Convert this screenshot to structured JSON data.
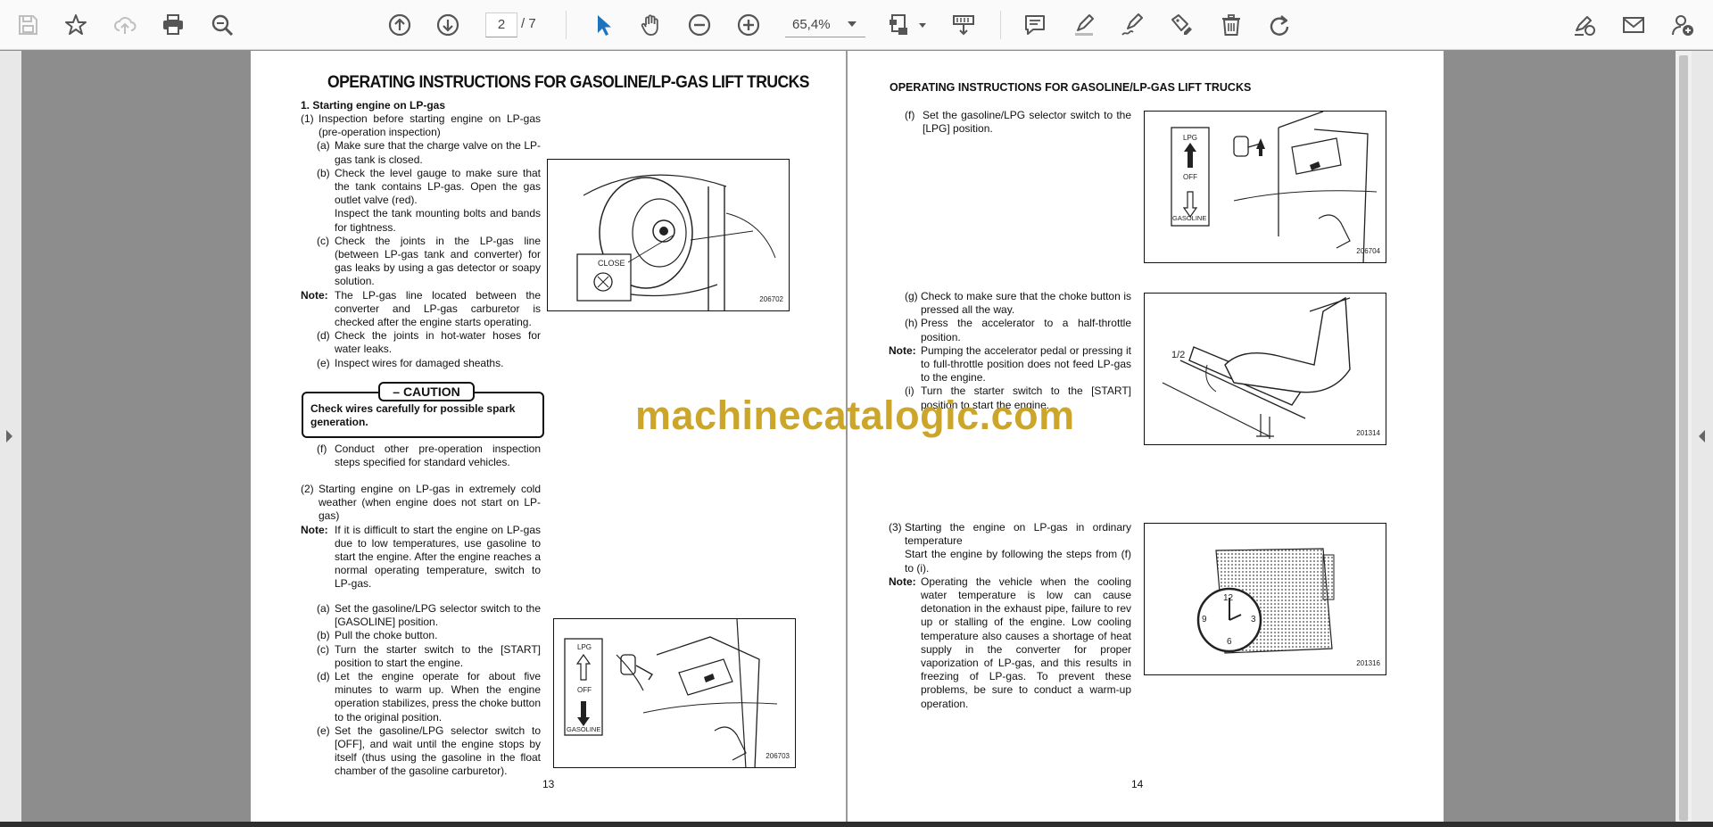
{
  "toolbar": {
    "current_page": "2",
    "total_pages": "/ 7",
    "zoom": "65,4%",
    "icons": [
      "save-icon",
      "bookmark-star-icon",
      "cloud-upload-icon",
      "print-icon",
      "zoom-search-icon",
      "page-up-icon",
      "page-down-icon",
      "select-cursor-icon",
      "hand-pan-icon",
      "zoom-out-icon",
      "zoom-in-icon",
      "fit-page-icon",
      "scroll-mode-icon",
      "comment-icon",
      "highlight-pen-icon",
      "draw-signature-icon",
      "stamp-edit-icon",
      "delete-icon",
      "redo-icon",
      "fill-sign-icon",
      "email-icon",
      "add-user-icon"
    ],
    "accent": "#1e73be"
  },
  "left_page": {
    "title": "OPERATING INSTRUCTIONS FOR GASOLINE/LP-GAS LIFT TRUCKS",
    "section1": "1. Starting engine on LP-gas",
    "item1_lab": "(1)",
    "item1_txt": "Inspection before starting engine on LP-gas (pre-operation inspection)",
    "a_lab": "(a)",
    "a_txt": "Make sure that the charge valve on the LP-gas tank is closed.",
    "b_lab": "(b)",
    "b_txt": "Check the level gauge to make sure that the tank contains LP-gas. Open the gas outlet valve (red).",
    "b_txt2": "Inspect the tank mounting bolts and bands for tightness.",
    "c_lab": "(c)",
    "c_txt": "Check the joints in the LP-gas line (between LP-gas tank and converter) for gas leaks by using a gas detector or soapy solution.",
    "note1_lab": "Note:",
    "note1_txt": "The LP-gas line located between the converter and LP-gas carburetor is checked after the engine starts operating.",
    "d_lab": "(d)",
    "d_txt": "Check the joints in hot-water hoses for water leaks.",
    "e_lab": "(e)",
    "e_txt": "Inspect wires for damaged sheaths.",
    "caution_head": "– CAUTION",
    "caution_text": "Check wires carefully for possible spark generation.",
    "f_lab": "(f)",
    "f_txt": "Conduct other pre-operation inspection steps specified for standard vehicles.",
    "item2_lab": "(2)",
    "item2_txt": "Starting engine on LP-gas in extremely cold weather (when engine does not start on LP-gas)",
    "note2_lab": "Note:",
    "note2_txt": "If it is difficult to start the engine on LP-gas due to low temperatures, use gasoline to start the engine. After the engine reaches a normal operating temperature, switch to LP-gas.",
    "a2_lab": "(a)",
    "a2_txt": "Set the gasoline/LPG selector switch to the [GASOLINE] position.",
    "b2_lab": "(b)",
    "b2_txt": "Pull the choke button.",
    "c2_lab": "(c)",
    "c2_txt": "Turn the starter switch to the [START] position to start the engine.",
    "d2_lab": "(d)",
    "d2_txt": "Let the engine operate for about five minutes to warm up. When the engine operation stabilizes, press the choke button to the original position.",
    "e2_lab": "(e)",
    "e2_txt": "Set the gasoline/LPG selector switch to [OFF], and wait until the engine stops by itself (thus using the gasoline in the float chamber of the gasoline carburetor).",
    "fig1_code": "206702",
    "fig1_close": "CLOSE",
    "fig2_code": "206703",
    "fig2_lpg": "LPG",
    "fig2_off": "OFF",
    "fig2_gasoline": "GASOLINE",
    "page_number": "13"
  },
  "right_page": {
    "title": "OPERATING INSTRUCTIONS FOR GASOLINE/LP-GAS LIFT TRUCKS",
    "f_lab": "(f)",
    "f_txt": "Set the gasoline/LPG selector switch to the [LPG] position.",
    "g_lab": "(g)",
    "g_txt": "Check to make sure that the choke button is pressed all the way.",
    "h_lab": "(h)",
    "h_txt": "Press the accelerator to a half-throttle position.",
    "note1_lab": "Note:",
    "note1_txt": "Pumping the accelerator pedal or pressing it to full-throttle position does not feed LP-gas to the engine.",
    "i_lab": "(i)",
    "i_txt": "Turn the starter switch to the [START] position to start the engine.",
    "item3_lab": "(3)",
    "item3_txt": "Starting the engine on LP-gas in ordinary temperature",
    "item3_txt2": "Start the engine by following the steps from (f) to (i).",
    "note2_lab": "Note:",
    "note2_txt": "Operating the vehicle when the cooling water temperature is low can cause detonation in the exhaust pipe, failure to rev up or stalling of the engine. Low cooling temperature also causes a shortage of heat supply in the converter for proper vaporization of LP-gas, and this results in freezing of LP-gas. To prevent these problems, be sure to conduct a warm-up operation.",
    "fig3_code": "206704",
    "fig3_lpg": "LPG",
    "fig3_off": "OFF",
    "fig3_gasoline": "GASOLINE",
    "fig4_code": "201314",
    "fig4_half": "1/2",
    "fig5_code": "201316",
    "clock_12": "12",
    "clock_3": "3",
    "clock_6": "6",
    "clock_9": "9",
    "page_number": "14"
  },
  "watermark": "machinecatalogic.com"
}
